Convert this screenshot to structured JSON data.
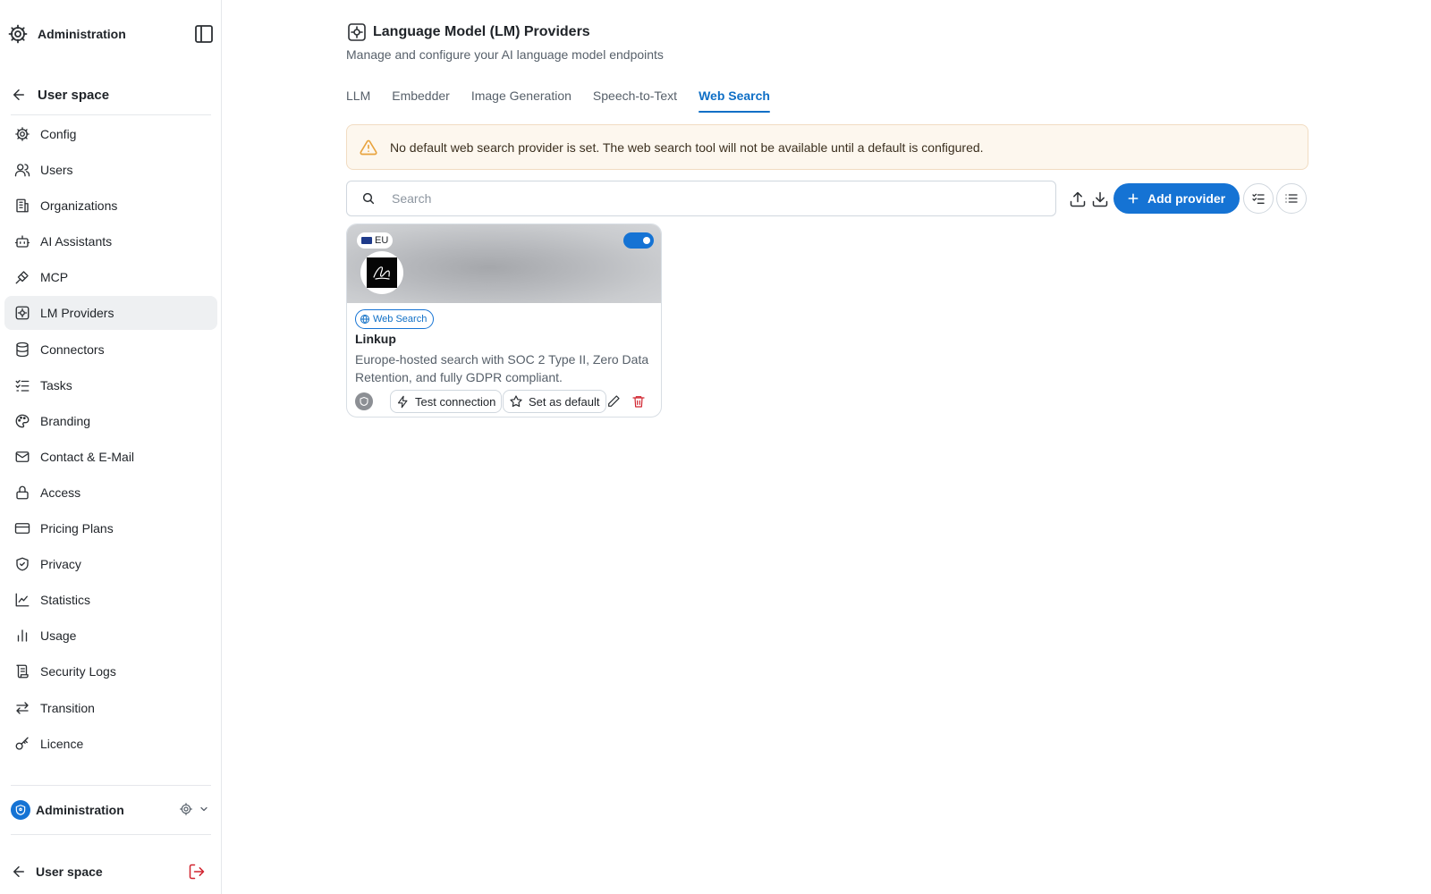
{
  "sidebar": {
    "title": "Administration",
    "back_label": "User space",
    "items": [
      {
        "label": "Config",
        "icon": "gear-icon"
      },
      {
        "label": "Users",
        "icon": "users-icon"
      },
      {
        "label": "Organizations",
        "icon": "building-icon"
      },
      {
        "label": "AI Assistants",
        "icon": "bot-icon"
      },
      {
        "label": "MCP",
        "icon": "plug-icon"
      },
      {
        "label": "LM Providers",
        "icon": "provider-icon",
        "active": true
      },
      {
        "label": "Connectors",
        "icon": "database-icon"
      },
      {
        "label": "Tasks",
        "icon": "list-checks-icon"
      },
      {
        "label": "Branding",
        "icon": "palette-icon"
      },
      {
        "label": "Contact & E-Mail",
        "icon": "mail-icon"
      },
      {
        "label": "Access",
        "icon": "lock-icon"
      },
      {
        "label": "Pricing Plans",
        "icon": "credit-card-icon"
      },
      {
        "label": "Privacy",
        "icon": "shield-check-icon"
      },
      {
        "label": "Statistics",
        "icon": "line-chart-icon"
      },
      {
        "label": "Usage",
        "icon": "bar-chart-icon"
      },
      {
        "label": "Security Logs",
        "icon": "scroll-icon"
      },
      {
        "label": "Transition",
        "icon": "arrows-left-right-icon"
      },
      {
        "label": "Licence",
        "icon": "key-icon"
      }
    ],
    "org_label": "Administration",
    "footer_label": "User space"
  },
  "page": {
    "title": "Language Model (LM) Providers",
    "subtitle": "Manage and configure your AI language model endpoints",
    "tabs": [
      {
        "label": "LLM",
        "active": false
      },
      {
        "label": "Embedder",
        "active": false
      },
      {
        "label": "Image Generation",
        "active": false
      },
      {
        "label": "Speech-to-Text",
        "active": false
      },
      {
        "label": "Web Search",
        "active": true
      }
    ],
    "warning": "No default web search provider is set. The web search tool will not be available until a default is configured.",
    "search_placeholder": "Search",
    "add_provider_label": "Add provider"
  },
  "cards": [
    {
      "region": "EU",
      "enabled": true,
      "tag": "Web Search",
      "name": "Linkup",
      "description": "Europe-hosted search with SOC 2 Type II, Zero Data Retention, and fully GDPR compliant.",
      "test_label": "Test connection",
      "default_label": "Set as default"
    }
  ],
  "colors": {
    "accent": "#1573d4",
    "warning_bg": "#fdf7ee",
    "warning_icon": "#e8a33d",
    "delete": "#d1242f"
  }
}
